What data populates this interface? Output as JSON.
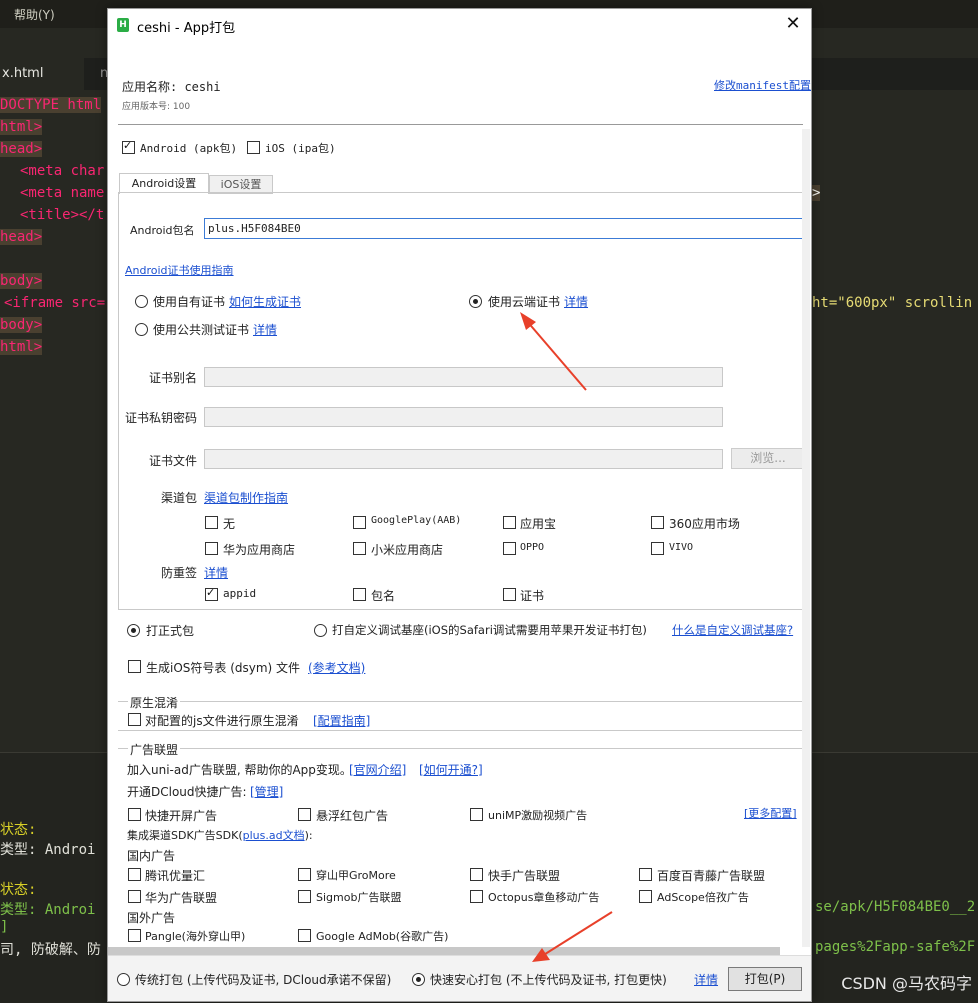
{
  "background": {
    "menu_help": "帮助(Y)",
    "tab_file": "x.html",
    "tab_other": "n",
    "code_lines": [
      "DOCTYPE html",
      "html>",
      "head>",
      "<meta char",
      "<meta name",
      "<title></t",
      "head>",
      "",
      "body>",
      "<iframe src=",
      "body>",
      "html>"
    ],
    "code_right_1": ">",
    "code_right_2": "ht=\"600px\" scrollin",
    "console": {
      "line1": "状态:",
      "line2": "类型: Androi",
      "line3": "状态:",
      "line4": "类型: Androi",
      "line4_right": "se/apk/H5F084BE0__2",
      "line5": "]",
      "line6": "司, 防破解、防",
      "line6_right": "pages%2Fapp-safe%2F"
    },
    "watermark": "CSDN @马农码字"
  },
  "dialog": {
    "title": "ceshi - App打包",
    "app_icon": "H",
    "app_name_label": "应用名称: ceshi",
    "app_version_label": "应用版本号: 100",
    "modify_manifest_link": "修改manifest配置",
    "platform_android": "Android (apk包)",
    "platform_ios": "iOS (ipa包)",
    "tab_android": "Android设置",
    "tab_ios": "iOS设置",
    "package_name_label": "Android包名",
    "package_name_value": "plus.H5F084BE0",
    "cert_guide_link": "Android证书使用指南",
    "cert_own": "使用自有证书",
    "cert_own_link": "如何生成证书",
    "cert_cloud": "使用云端证书",
    "cert_cloud_link": "详情",
    "cert_public": "使用公共测试证书",
    "cert_public_link": "详情",
    "cert_alias_label": "证书别名",
    "cert_key_label": "证书私钥密码",
    "cert_file_label": "证书文件",
    "browse_button": "浏览...",
    "channel_label": "渠道包",
    "channel_link": "渠道包制作指南",
    "channels": [
      {
        "label": "无",
        "checked": false
      },
      {
        "label": "GooglePlay(AAB)",
        "checked": false
      },
      {
        "label": "应用宝",
        "checked": false
      },
      {
        "label": "360应用市场",
        "checked": false
      },
      {
        "label": "华为应用商店",
        "checked": false
      },
      {
        "label": "小米应用商店",
        "checked": false
      },
      {
        "label": "OPPO",
        "checked": false
      },
      {
        "label": "VIVO",
        "checked": false
      }
    ],
    "anti_tamper_label": "防重签",
    "anti_tamper_link": "详情",
    "anti_tamper": [
      {
        "label": "appid",
        "checked": true
      },
      {
        "label": "包名",
        "checked": false
      },
      {
        "label": "证书",
        "checked": false
      }
    ],
    "build_release": "打正式包",
    "build_custom_base": "打自定义调试基座(iOS的Safari调试需要用苹果开发证书打包)",
    "custom_base_link": "什么是自定义调试基座?",
    "ios_dsym": "生成iOS符号表 (dsym) 文件",
    "ios_dsym_link": "(参考文档)",
    "native_obf_title": "原生混淆",
    "native_obf_option": "对配置的js文件进行原生混淆",
    "native_obf_link": "[配置指南]",
    "ad_title": "广告联盟",
    "ad_join_text": "加入uni-ad广告联盟, 帮助你的App变现。",
    "ad_intro_link": "[官网介绍]",
    "ad_howto_link": "[如何开通?]",
    "ad_dcloud_text": "开通DCloud快捷广告:",
    "ad_manage_link": "[管理]",
    "ad_quick": [
      "快捷开屏广告",
      "悬浮红包广告",
      "uniMP激励视频广告"
    ],
    "ad_more_link": "[更多配置]",
    "ad_sdk_prefix": "集成渠道SDK广告SDK(",
    "ad_sdk_link": "plus.ad文档",
    "ad_sdk_suffix": "):",
    "ad_domestic_title": "国内广告",
    "ad_domestic": [
      "腾讯优量汇",
      "穿山甲GroMore",
      "快手广告联盟",
      "百度百青藤广告联盟",
      "华为广告联盟",
      "Sigmob广告联盟",
      "Octopus章鱼移动广告",
      "AdScope倍孜广告"
    ],
    "ad_foreign_title": "国外广告",
    "ad_foreign": [
      "Pangle(海外穿山甲)",
      "Google AdMob(谷歌广告)"
    ],
    "pack_traditional": "传统打包 (上传代码及证书, DCloud承诺不保留)",
    "pack_fast": "快速安心打包 (不上传代码及证书, 打包更快)",
    "pack_fast_link": "详情",
    "pack_button": "打包(P)",
    "colors": {
      "link": "#1b4fd0",
      "arrow": "#e8402a",
      "dialog_bg": "#ffffff"
    }
  }
}
